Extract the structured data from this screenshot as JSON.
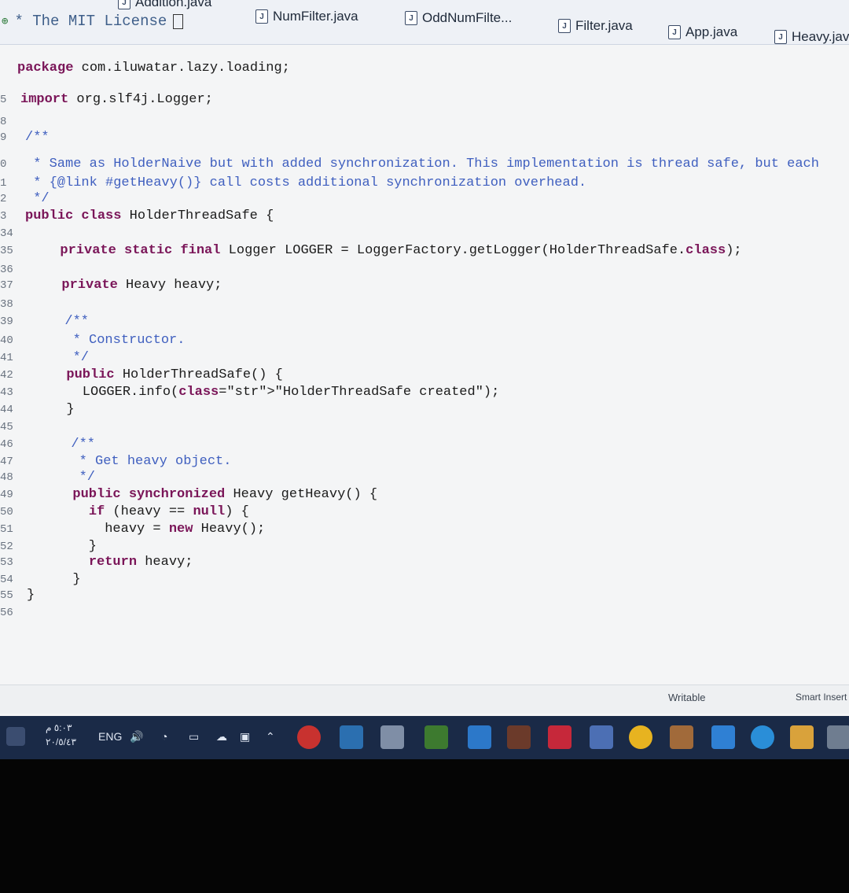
{
  "tabs": [
    {
      "label": "Addition.java"
    },
    {
      "label": "NumFilter.java"
    },
    {
      "label": "OddNumFilte..."
    },
    {
      "label": "Filter.java"
    },
    {
      "label": "App.java"
    },
    {
      "label": "Heavy.java"
    }
  ],
  "header": {
    "license_comment": "* The MIT License"
  },
  "code_lines": [
    {
      "num": "",
      "text": "package com.iluwatar.lazy.loading;"
    },
    {
      "num": "5",
      "text": "import org.slf4j.Logger;"
    },
    {
      "num": "8",
      "text": ""
    },
    {
      "num": "9",
      "text": "/**"
    },
    {
      "num": "0",
      "text": " * Same as HolderNaive but with added synchronization. This implementation is thread safe, but each"
    },
    {
      "num": "1",
      "text": " * {@link #getHeavy()} call costs additional synchronization overhead."
    },
    {
      "num": "2",
      "text": " */"
    },
    {
      "num": "3",
      "text": "public class HolderThreadSafe {"
    },
    {
      "num": "34",
      "text": ""
    },
    {
      "num": "35",
      "text": "  private static final Logger LOGGER = LoggerFactory.getLogger(HolderThreadSafe.class);"
    },
    {
      "num": "36",
      "text": ""
    },
    {
      "num": "37",
      "text": "  private Heavy heavy;"
    },
    {
      "num": "38",
      "text": ""
    },
    {
      "num": "39",
      "text": "  /**"
    },
    {
      "num": "40",
      "text": "   * Constructor."
    },
    {
      "num": "41",
      "text": "   */"
    },
    {
      "num": "42",
      "text": "  public HolderThreadSafe() {"
    },
    {
      "num": "43",
      "text": "    LOGGER.info(\"HolderThreadSafe created\");"
    },
    {
      "num": "44",
      "text": "  }"
    },
    {
      "num": "45",
      "text": ""
    },
    {
      "num": "46",
      "text": "  /**"
    },
    {
      "num": "47",
      "text": "   * Get heavy object."
    },
    {
      "num": "48",
      "text": "   */"
    },
    {
      "num": "49",
      "text": "  public synchronized Heavy getHeavy() {"
    },
    {
      "num": "50",
      "text": "    if (heavy == null) {"
    },
    {
      "num": "51",
      "text": "      heavy = new Heavy();"
    },
    {
      "num": "52",
      "text": "    }"
    },
    {
      "num": "53",
      "text": "    return heavy;"
    },
    {
      "num": "54",
      "text": "  }"
    },
    {
      "num": "55",
      "text": "}"
    },
    {
      "num": "56",
      "text": ""
    }
  ],
  "status": {
    "writable": "Writable",
    "insert_mode": "Smart Insert"
  },
  "taskbar": {
    "time": "٥:٠٣ م",
    "date": "٢٠/٥/٤٣",
    "language": "ENG",
    "colors": {
      "background": "#1a2a47"
    }
  }
}
